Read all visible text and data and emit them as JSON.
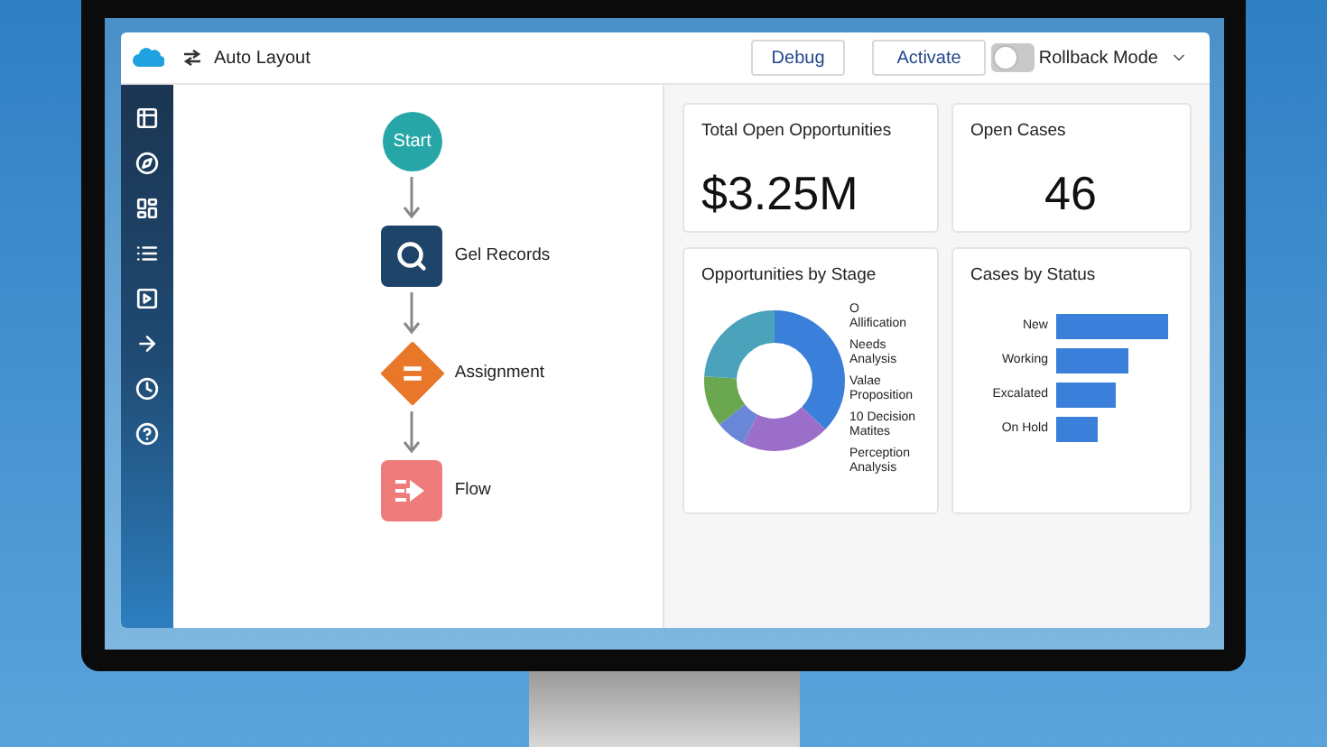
{
  "toolbar": {
    "title": "Auto Layout",
    "buttons": [
      "Debug",
      "Activate"
    ],
    "rollback": {
      "label": "Rollback Mode",
      "on": false
    }
  },
  "flow": {
    "nodes": [
      {
        "kind": "start",
        "label": "Start"
      },
      {
        "kind": "records",
        "label": "Gel Records"
      },
      {
        "kind": "assignment",
        "label": "Assignment"
      },
      {
        "kind": "subflow",
        "label": "Flow"
      }
    ]
  },
  "metrics": [
    {
      "title": "Total Open Opportunities",
      "value": "$3.25M"
    },
    {
      "title": "Open Cases",
      "value": "46"
    }
  ],
  "stage_chart": {
    "title": "Opportunities by Stage",
    "legend": [
      "O Allification",
      "Needs Analysis",
      "Valae Proposition",
      "10 Decision Matites",
      "Perception Analysis"
    ]
  },
  "status_chart": {
    "title": "Cases by Status",
    "labels": [
      "New",
      "Working",
      "Excalated",
      "On Hold"
    ]
  }
}
